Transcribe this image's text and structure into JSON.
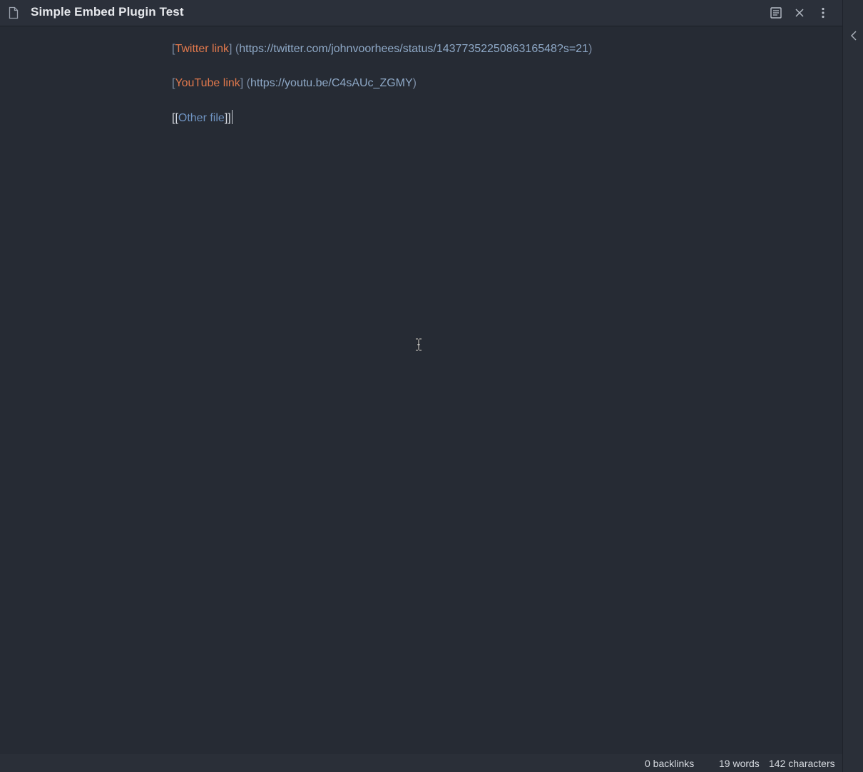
{
  "header": {
    "title": "Simple Embed Plugin Test",
    "icons": {
      "file": "file-icon",
      "reading_view": "reading-view-icon",
      "close": "close-icon",
      "more": "more-vertical-icon"
    }
  },
  "sidebar": {
    "expand_icon": "chevron-left-icon"
  },
  "editor": {
    "lines": [
      {
        "open_bracket": "[",
        "link_text": "Twitter link",
        "close_bracket": "]",
        "url_open": " (",
        "url": "https://twitter.com/johnvoorhees/status/1437735225086316548?s=21",
        "url_close": ")"
      },
      {
        "open_bracket": "[",
        "link_text": "YouTube link",
        "close_bracket": "]",
        "url_open": " (",
        "url": "https://youtu.be/C4sAUc_ZGMY",
        "url_close": ")"
      }
    ],
    "wikilink": {
      "open": "[[",
      "text": "Other file",
      "close": "]]"
    }
  },
  "status_bar": {
    "backlinks": "0 backlinks",
    "words": "19 words",
    "characters": "142 characters"
  },
  "colors": {
    "background": "#262b34",
    "link_text": "#e0784c",
    "url": "#8ea8c6",
    "wikilink": "#6f93c1",
    "bracket": "#7c8da5",
    "title": "#e6e8ec"
  }
}
